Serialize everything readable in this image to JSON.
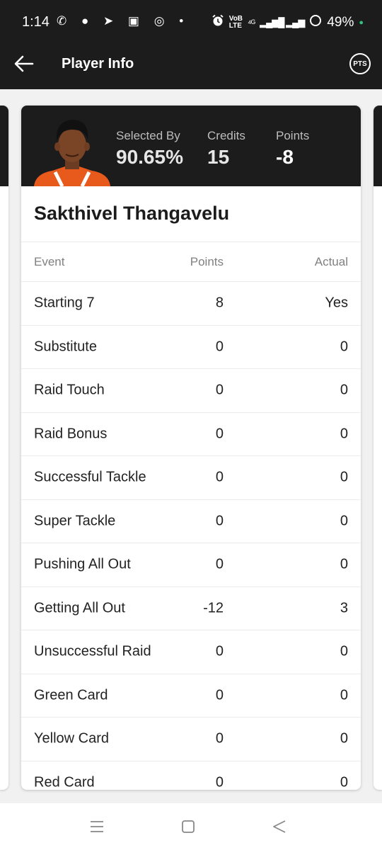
{
  "status_bar": {
    "time": "1:14",
    "left_icons": "✆ ● ➤ ▣ ◎ •",
    "net_top": "VoB",
    "net_bottom": "LTE",
    "network": "⁴ᴳ",
    "signal": "▂▄▆█ ▂▄▆",
    "battery": "49%"
  },
  "app_bar": {
    "title": "Player Info",
    "pts_label": "PTS"
  },
  "player": {
    "name": "Sakthivel Thangavelu",
    "selected_by_label": "Selected By",
    "selected_by": "90.65%",
    "credits_label": "Credits",
    "credits": "15",
    "points_label": "Points",
    "points": "-8",
    "jersey_color": "#e85a1c"
  },
  "table": {
    "headers": {
      "event": "Event",
      "points": "Points",
      "actual": "Actual"
    },
    "rows": [
      {
        "event": "Starting 7",
        "points": "8",
        "actual": "Yes"
      },
      {
        "event": "Substitute",
        "points": "0",
        "actual": "0"
      },
      {
        "event": "Raid Touch",
        "points": "0",
        "actual": "0"
      },
      {
        "event": "Raid Bonus",
        "points": "0",
        "actual": "0"
      },
      {
        "event": "Successful Tackle",
        "points": "0",
        "actual": "0"
      },
      {
        "event": "Super Tackle",
        "points": "0",
        "actual": "0"
      },
      {
        "event": "Pushing All Out",
        "points": "0",
        "actual": "0"
      },
      {
        "event": "Getting All Out",
        "points": "-12",
        "actual": "3"
      },
      {
        "event": "Unsuccessful Raid",
        "points": "0",
        "actual": "0"
      },
      {
        "event": "Green Card",
        "points": "0",
        "actual": "0"
      },
      {
        "event": "Yellow Card",
        "points": "0",
        "actual": "0"
      },
      {
        "event": "Red Card",
        "points": "0",
        "actual": "0"
      }
    ]
  },
  "nav_bar": {
    "icons": [
      "menu-icon",
      "home-icon",
      "back-triangle-icon"
    ]
  }
}
